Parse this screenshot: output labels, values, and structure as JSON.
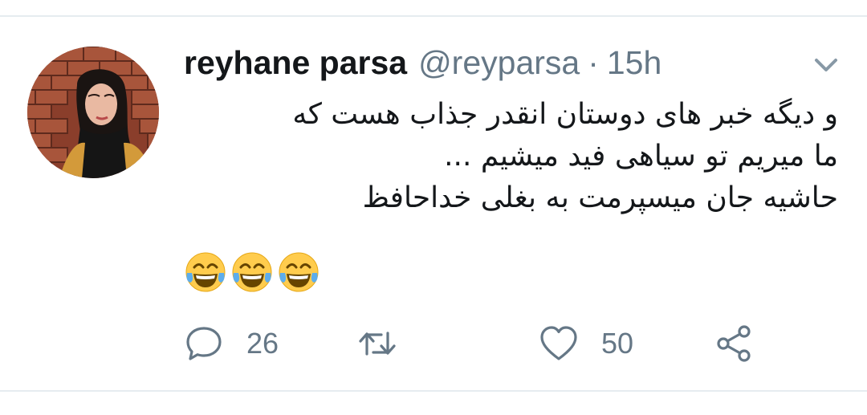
{
  "tweet": {
    "author_name": "reyhane parsa",
    "handle": "@reyparsa",
    "separator": "·",
    "time": "15h",
    "text_lines": [
      "و دیگه خبر های دوستان انقدر جذاب هست که",
      "ما میریم تو سیاهی فید میشیم ...",
      "حاشیه  جان میسپرمت به بغلی خداحافظ"
    ],
    "emoji": [
      "face-with-tears-of-joy",
      "face-with-tears-of-joy",
      "face-with-tears-of-joy"
    ]
  },
  "actions": {
    "reply_count": "26",
    "retweet_count": "",
    "like_count": "50"
  },
  "colors": {
    "text": "#14171a",
    "secondary": "#657786",
    "divider": "#e6ecf0"
  },
  "icons": {
    "caret": "chevron-down-icon",
    "reply": "reply-icon",
    "retweet": "retweet-icon",
    "like": "heart-icon",
    "share": "share-icon"
  }
}
